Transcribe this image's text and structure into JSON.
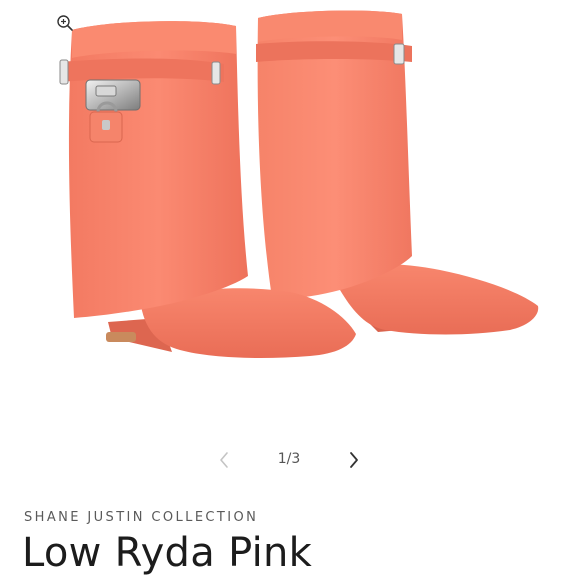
{
  "gallery": {
    "image_description_icon": "boot-product-image",
    "zoom_icon": "zoom-in-icon",
    "prev_icon": "chevron-left-icon",
    "next_icon": "chevron-right-icon",
    "slide_counter": "1/3",
    "accent_color": "#f57b64"
  },
  "product": {
    "vendor": "SHANE JUSTIN COLLECTION",
    "title": "Low Ryda Pink"
  }
}
